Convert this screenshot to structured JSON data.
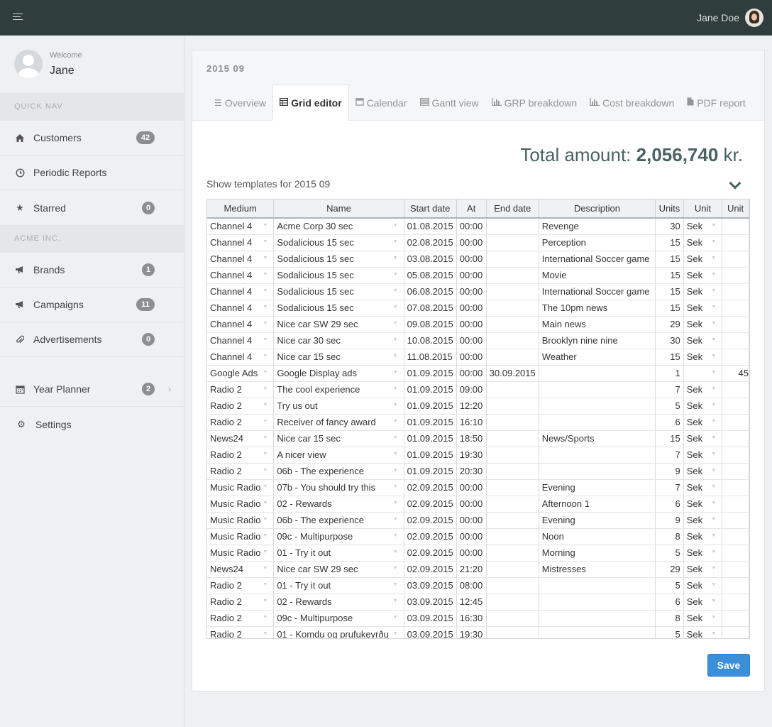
{
  "topbar": {
    "user_name": "Jane Doe"
  },
  "sidebar": {
    "welcome_label": "Welcome",
    "welcome_name": "Jane",
    "sections": {
      "quick_nav": "QUICK NAV",
      "acme": "ACME INC."
    },
    "items": [
      {
        "label": "Customers",
        "badge": "42",
        "icon": "home-icon"
      },
      {
        "label": "Periodic Reports",
        "icon": "clock-icon"
      },
      {
        "label": "Starred",
        "badge": "0",
        "icon": "star-icon"
      },
      {
        "label": "Brands",
        "badge": "1",
        "icon": "bullhorn-icon"
      },
      {
        "label": "Campaigns",
        "badge": "11",
        "icon": "bullhorn-icon"
      },
      {
        "label": "Advertisements",
        "badge": "0",
        "icon": "paperclip-icon"
      },
      {
        "label": "Year Planner",
        "badge": "2",
        "icon": "calendar-icon"
      },
      {
        "label": "Settings",
        "icon": "gear-icon"
      }
    ]
  },
  "panel": {
    "period": "2015 09",
    "tabs": [
      {
        "label": "Overview",
        "icon": "list-icon"
      },
      {
        "label": "Grid editor",
        "icon": "table-icon",
        "active": true
      },
      {
        "label": "Calendar",
        "icon": "calendar-icon"
      },
      {
        "label": "Gantt view",
        "icon": "tasks-icon"
      },
      {
        "label": "GRP breakdown",
        "icon": "bar-chart-icon"
      },
      {
        "label": "Cost breakdown",
        "icon": "bar-chart-icon"
      },
      {
        "label": "PDF report",
        "icon": "file-icon"
      }
    ],
    "total_label": "Total amount:",
    "total_value": "2,056,740",
    "total_unit": "kr.",
    "templates_label": "Show templates for 2015 09",
    "save_label": "Save"
  },
  "grid": {
    "columns": [
      "Medium",
      "Name",
      "Start date",
      "At",
      "End date",
      "Description",
      "Units",
      "Unit",
      "Unit"
    ],
    "rows": [
      [
        "Channel 4",
        "Acme Corp 30 sec",
        "01.08.2015",
        "00:00",
        "",
        "Revenge",
        "30",
        "Sek",
        ""
      ],
      [
        "Channel 4",
        "Sodalicious 15 sec",
        "02.08.2015",
        "00:00",
        "",
        "Perception",
        "15",
        "Sek",
        ""
      ],
      [
        "Channel 4",
        "Sodalicious 15 sec",
        "03.08.2015",
        "00:00",
        "",
        "International Soccer game",
        "15",
        "Sek",
        ""
      ],
      [
        "Channel 4",
        "Sodalicious 15 sec",
        "05.08.2015",
        "00:00",
        "",
        "Movie",
        "15",
        "Sek",
        ""
      ],
      [
        "Channel 4",
        "Sodalicious 15 sec",
        "06.08.2015",
        "00:00",
        "",
        "International Soccer game",
        "15",
        "Sek",
        ""
      ],
      [
        "Channel 4",
        "Sodalicious 15 sec",
        "07.08.2015",
        "00:00",
        "",
        "The 10pm news",
        "15",
        "Sek",
        ""
      ],
      [
        "Channel 4",
        "Nice car SW 29 sec",
        "09.08.2015",
        "00:00",
        "",
        "Main news",
        "29",
        "Sek",
        ""
      ],
      [
        "Channel 4",
        "Nice car 30 sec",
        "10.08.2015",
        "00:00",
        "",
        "Brooklyn nine nine",
        "30",
        "Sek",
        ""
      ],
      [
        "Channel 4",
        "Nice car 15 sec",
        "11.08.2015",
        "00:00",
        "",
        "Weather",
        "15",
        "Sek",
        ""
      ],
      [
        "Google Ads",
        "Google Display ads",
        "01.09.2015",
        "00:00",
        "30.09.2015",
        "",
        "1",
        "",
        "45"
      ],
      [
        "Radio 2",
        "The cool experience",
        "01.09.2015",
        "09:00",
        "",
        "",
        "7",
        "Sek",
        ""
      ],
      [
        "Radio 2",
        "Try us out",
        "01.09.2015",
        "12:20",
        "",
        "",
        "5",
        "Sek",
        ""
      ],
      [
        "Radio 2",
        "Receiver of fancy award",
        "01.09.2015",
        "16:10",
        "",
        "",
        "6",
        "Sek",
        ""
      ],
      [
        "News24",
        "Nice car 15 sec",
        "01.09.2015",
        "18:50",
        "",
        "News/Sports",
        "15",
        "Sek",
        ""
      ],
      [
        "Radio 2",
        "A nicer view",
        "01.09.2015",
        "19:30",
        "",
        "",
        "7",
        "Sek",
        ""
      ],
      [
        "Radio 2",
        "06b - The experience",
        "01.09.2015",
        "20:30",
        "",
        "",
        "9",
        "Sek",
        ""
      ],
      [
        "Music Radio",
        "07b - You should try this",
        "02.09.2015",
        "00:00",
        "",
        "Evening",
        "7",
        "Sek",
        ""
      ],
      [
        "Music Radio",
        "02 - Rewards",
        "02.09.2015",
        "00:00",
        "",
        "Afternoon 1",
        "6",
        "Sek",
        ""
      ],
      [
        "Music Radio",
        "06b - The experience",
        "02.09.2015",
        "00:00",
        "",
        "Evening",
        "9",
        "Sek",
        ""
      ],
      [
        "Music Radio",
        "09c - Multipurpose",
        "02.09.2015",
        "00:00",
        "",
        "Noon",
        "8",
        "Sek",
        ""
      ],
      [
        "Music Radio",
        "01 - Try it out",
        "02.09.2015",
        "00:00",
        "",
        "Morning",
        "5",
        "Sek",
        ""
      ],
      [
        "News24",
        "Nice car SW 29 sec",
        "02.09.2015",
        "21:20",
        "",
        "Mistresses",
        "29",
        "Sek",
        ""
      ],
      [
        "Radio 2",
        "01 - Try it out",
        "03.09.2015",
        "08:00",
        "",
        "",
        "5",
        "Sek",
        ""
      ],
      [
        "Radio 2",
        "02 - Rewards",
        "03.09.2015",
        "12:45",
        "",
        "",
        "6",
        "Sek",
        ""
      ],
      [
        "Radio 2",
        "09c - Multipurpose",
        "03.09.2015",
        "16:30",
        "",
        "",
        "8",
        "Sek",
        ""
      ],
      [
        "Radio 2",
        "01 - Komdu og prufukeyrðu",
        "03.09.2015",
        "19:30",
        "",
        "",
        "5",
        "Sek",
        ""
      ]
    ]
  }
}
